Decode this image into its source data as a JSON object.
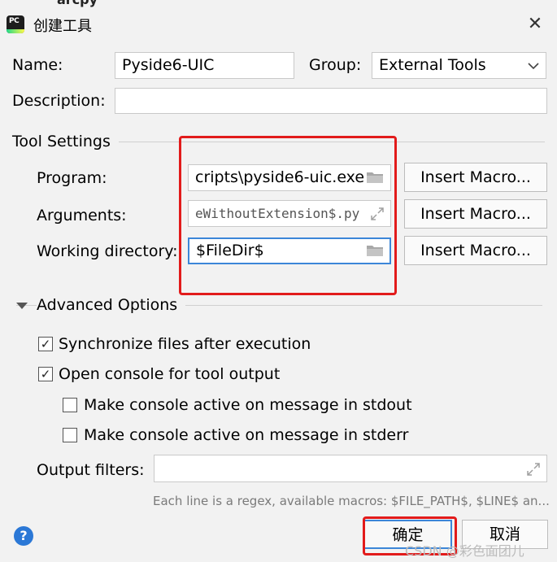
{
  "window": {
    "title": "创建工具",
    "close_symbol": "✕",
    "bg_text": "arcpy"
  },
  "app_icon_text": "PC",
  "name": {
    "label": "Name:",
    "value": "Pyside6-UIC"
  },
  "group": {
    "label": "Group:",
    "value": "External Tools"
  },
  "description": {
    "label": "Description:",
    "value": ""
  },
  "tool_settings": {
    "title": "Tool Settings",
    "program": {
      "label": "Program:",
      "value": "cripts\\pyside6-uic.exe"
    },
    "arguments": {
      "label": "Arguments:",
      "value": "eWithoutExtension$.py"
    },
    "working_dir": {
      "label": "Working directory:",
      "value": "$FileDir$"
    },
    "insert_macro_label": "Insert Macro..."
  },
  "advanced": {
    "title": "Advanced Options",
    "sync_files": {
      "label": "Synchronize files after execution",
      "checked": true
    },
    "open_console": {
      "label": "Open console for tool output",
      "checked": true
    },
    "active_stdout": {
      "label": "Make console active on message in stdout",
      "checked": false
    },
    "active_stderr": {
      "label": "Make console active on message in stderr",
      "checked": false
    },
    "output_filters": {
      "label": "Output filters:",
      "value": ""
    },
    "hint": "Each line is a regex, available macros: $FILE_PATH$, $LINE$ an..."
  },
  "footer": {
    "help_symbol": "?",
    "ok_label": "确定",
    "cancel_label": "取消",
    "watermark": "CSDN @彩色面团儿"
  },
  "colors": {
    "accent": "#3c86d8",
    "highlight": "#e21b1b"
  }
}
